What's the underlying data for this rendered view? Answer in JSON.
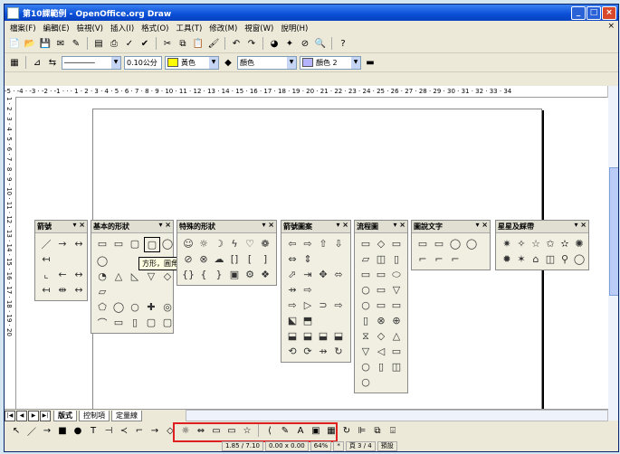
{
  "window": {
    "title": "第10課範例 - OpenOffice.org Draw"
  },
  "menu": [
    "檔案(F)",
    "編輯(E)",
    "檢視(V)",
    "插入(I)",
    "格式(O)",
    "工具(T)",
    "修改(M)",
    "視窗(W)",
    "說明(H)"
  ],
  "line_toolbar": {
    "width": "0.10公分",
    "fill_color": "黃色",
    "line_color": "顏色",
    "fill": "顏色 2"
  },
  "ruler_h": "-5 · -4 · -3 · -2 · -1 · · · 1 · 2 · 3 · 4 · 5 · 6 · 7 · 8 · 9 · 10 · 11 · 12 · 13 · 14 · 15 · 16 · 17 · 18 · 19 · 20 · 21 · 22 · 23 · 24 · 25 · 26 · 27 · 28 · 29 · 30 · 31 · 32 · 33 · 34",
  "ruler_v": "1 · 2 · 3 · 4 · 5 · 6 · 7 · 8 · 9 · 10 · 11 · 12 · 13 · 14 · 15 · 16 · 17 · 18 · 19 · 20",
  "palettes": [
    {
      "title": "箭號",
      "icons": [
        "／",
        "→",
        "↔",
        "↤",
        "",
        "",
        "⌞",
        "←",
        "↔",
        "↔",
        "↤",
        "↔"
      ]
    },
    {
      "title": "基本的形狀",
      "icons": [
        "▭",
        "▭",
        "▢",
        "▢",
        "◯",
        "◯",
        "",
        "",
        "",
        "",
        "◔",
        "△",
        "◺",
        "▽",
        "◇",
        "▱",
        "",
        "",
        "",
        "",
        "⬠",
        "◯",
        "○",
        "✚",
        "◎",
        "⌒",
        "▭",
        "▯",
        "▢",
        "▢"
      ]
    },
    {
      "title": "特殊的形狀",
      "icons": [
        "☺",
        "☼",
        "☽",
        "♡",
        "❁",
        "♨",
        "⊗",
        "☁",
        "{}",
        "[",
        "]",
        "",
        "{}",
        "{",
        "}",
        "▣",
        "⚙",
        "❖"
      ]
    },
    {
      "title": "箭號圖案",
      "icons": [
        "⇦",
        "⇨",
        "⇧",
        "⇩",
        "⇔",
        "⇕",
        "",
        "",
        "⬀",
        "⇥",
        "✥",
        "⬄",
        "⇸",
        "⇨",
        "",
        "",
        "⇨",
        "⇨",
        "⊃",
        "⇨",
        "⬕",
        "⬒",
        "",
        "",
        "⬓",
        "⬓",
        "⬓",
        "⬓",
        "⟲",
        "⟳",
        "⇸",
        "↻"
      ]
    },
    {
      "title": "流程圖",
      "icons": [
        "▭",
        "◇",
        "▭",
        "▱",
        "◫",
        "▯",
        "▭",
        "▭",
        "⬭",
        "○",
        "▭",
        "▽",
        "○",
        "▭",
        "▭",
        "▯",
        "⊗",
        "⊕",
        "⧖",
        "◇",
        "△",
        "▽",
        "◁",
        "▭",
        "○",
        "▯",
        "◫",
        "○"
      ]
    },
    {
      "title": "圖說文字",
      "icons": [
        "▭",
        "▭",
        "◯",
        "◯",
        "⌐",
        "⌐",
        "⌐",
        "⌐"
      ]
    },
    {
      "title": "星星及綵帶",
      "icons": [
        "✷",
        "✧",
        "☆",
        "✩",
        "✫",
        "✺",
        "✹",
        "✶",
        "⌂",
        "◫",
        "⚲",
        "◯"
      ]
    }
  ],
  "tooltip": "方形，圓角",
  "tabs": [
    "版式",
    "控制項",
    "定量線"
  ],
  "status": {
    "position": "1.85 / 7.10",
    "size": "0.00 x 0.00",
    "zoom": "64%",
    "page": "頁 3 / 4",
    "mode": "預設"
  }
}
